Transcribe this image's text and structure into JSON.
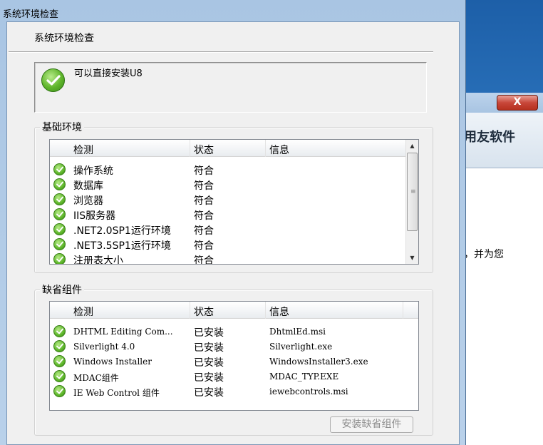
{
  "window": {
    "title": "系统环境检查",
    "heading": "系统环境检查",
    "status_message": "可以直接安装U8"
  },
  "background_window": {
    "close_label": "X",
    "banner_text": "用友软件",
    "side_text": "，并为您"
  },
  "basic_env": {
    "group_label": "基础环境",
    "columns": [
      "检测",
      "状态",
      "信息"
    ],
    "rows": [
      {
        "check": "操作系统",
        "status": "符合",
        "info": ""
      },
      {
        "check": "数据库",
        "status": "符合",
        "info": ""
      },
      {
        "check": "浏览器",
        "status": "符合",
        "info": ""
      },
      {
        "check": "IIS服务器",
        "status": "符合",
        "info": ""
      },
      {
        "check": ".NET2.0SP1运行环境",
        "status": "符合",
        "info": ""
      },
      {
        "check": ".NET3.5SP1运行环境",
        "status": "符合",
        "info": ""
      },
      {
        "check": "注册表大小",
        "status": "符合",
        "info": ""
      }
    ]
  },
  "default_components": {
    "group_label": "缺省组件",
    "columns": [
      "检测",
      "状态",
      "信息"
    ],
    "rows": [
      {
        "check": "DHTML Editing Com...",
        "status": "已安装",
        "info": "DhtmlEd.msi"
      },
      {
        "check": "Silverlight 4.0",
        "status": "已安装",
        "info": "Silverlight.exe"
      },
      {
        "check": "Windows Installer",
        "status": "已安装",
        "info": "WindowsInstaller3.exe"
      },
      {
        "check": "MDAC组件",
        "status": "已安装",
        "info": "MDAC_TYP.EXE"
      },
      {
        "check": "IE Web Control 组件",
        "status": "已安装",
        "info": "iewebcontrols.msi"
      }
    ]
  },
  "buttons": {
    "install_default": "安装缺省组件"
  },
  "colors": {
    "ok_green": "#5db52a",
    "desktop_blue": "#2b6fb4"
  }
}
